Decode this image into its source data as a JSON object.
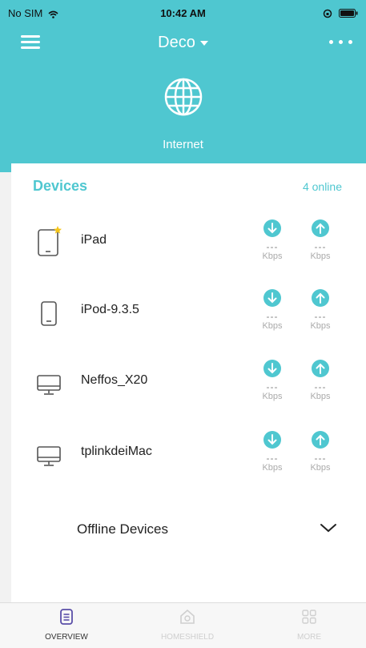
{
  "status_bar": {
    "carrier": "No SIM",
    "time": "10:42 AM"
  },
  "header": {
    "title": "Deco",
    "internet_label": "Internet"
  },
  "devices": {
    "title": "Devices",
    "online_count": "4 online",
    "items": [
      {
        "name": "iPad",
        "icon": "tablet-icon",
        "down": "---",
        "down_unit": "Kbps",
        "up": "---",
        "up_unit": "Kbps",
        "starred": true
      },
      {
        "name": "iPod-9.3.5",
        "icon": "phone-icon",
        "down": "---",
        "down_unit": "Kbps",
        "up": "---",
        "up_unit": "Kbps",
        "starred": false
      },
      {
        "name": "Neffos_X20",
        "icon": "monitor-icon",
        "down": "---",
        "down_unit": "Kbps",
        "up": "---",
        "up_unit": "Kbps",
        "starred": false
      },
      {
        "name": "tplinkdeiMac",
        "icon": "monitor-icon",
        "down": "---",
        "down_unit": "Kbps",
        "up": "---",
        "up_unit": "Kbps",
        "starred": false
      }
    ],
    "offline_label": "Offline Devices"
  },
  "tabs": [
    {
      "label": "OVERVIEW",
      "active": true
    },
    {
      "label": "HOMESHIELD",
      "active": false
    },
    {
      "label": "MORE",
      "active": false
    }
  ],
  "colors": {
    "accent": "#4fc7d0",
    "star": "#f5c518"
  }
}
